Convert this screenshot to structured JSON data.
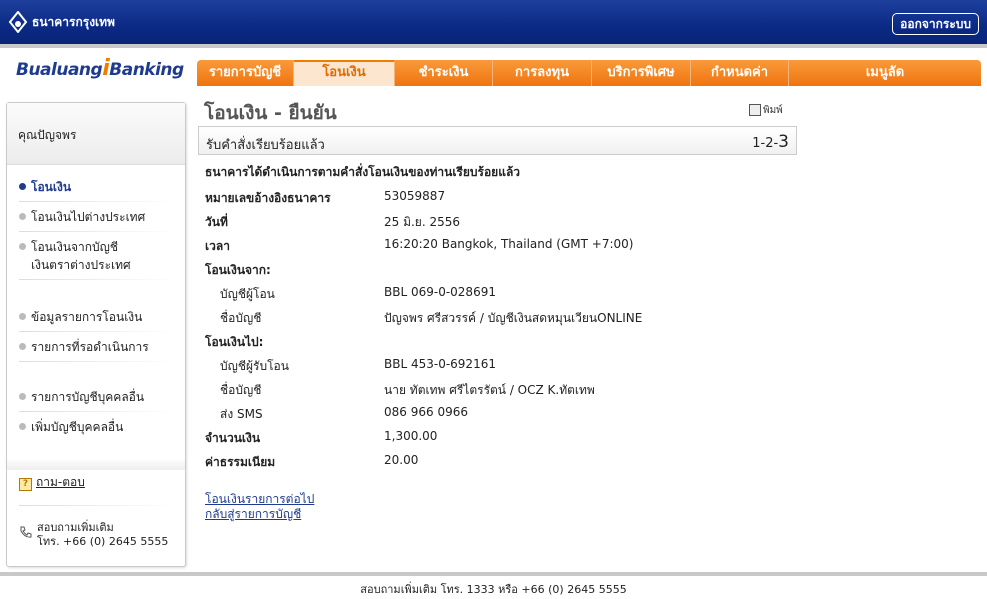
{
  "header": {
    "bank_name": "ธนาคารกรุงเทพ",
    "logout_label": "ออกจากระบบ"
  },
  "brand": {
    "part1": "Bualuang",
    "part2": "i",
    "part3": "Banking"
  },
  "nav": {
    "items": [
      {
        "label": "รายการบัญชี"
      },
      {
        "label": "โอนเงิน"
      },
      {
        "label": "ชำระเงิน"
      },
      {
        "label": "การลงทุน"
      },
      {
        "label": "บริการพิเศษ"
      },
      {
        "label": "กำหนดค่า"
      },
      {
        "label": "เมนูลัด"
      }
    ]
  },
  "sidebar": {
    "user_name": "คุณปัญจพร",
    "items": [
      {
        "label": "โอนเงิน"
      },
      {
        "label": "โอนเงินไปต่างประเทศ"
      },
      {
        "label": "โอนเงินจากบัญชี"
      },
      {
        "label": "เงินตราต่างประเทศ"
      },
      {
        "label": "ข้อมูลรายการโอนเงิน"
      },
      {
        "label": "รายการที่รอดำเนินการ"
      },
      {
        "label": "รายการบัญชีบุคคลอื่น"
      },
      {
        "label": "เพิ่มบัญชีบุคคลอื่น"
      }
    ],
    "faq_label": "ถาม-ตอบ",
    "contact_line1": "สอบถามเพิ่มเติม",
    "contact_line2": "โทร. +66 (0) 2645 5555"
  },
  "main": {
    "title": "โอนเงิน - ยืนยัน",
    "print_label": "พิมพ์",
    "status_text": "รับคำสั่งเรียบร้อยแล้ว",
    "step_prefix": "1-2-",
    "step_current": "3",
    "confirm_message": "ธนาคารได้ดำเนินการตามคำสั่งโอนเงินของท่านเรียบร้อยแล้ว",
    "details": {
      "ref_label": "หมายเลขอ้างอิงธนาคาร",
      "ref_value": "53059887",
      "date_label": "วันที่",
      "date_value": "25 มิ.ย. 2556",
      "time_label": "เวลา",
      "time_value": "16:20:20 Bangkok, Thailand (GMT +7:00)",
      "from_heading": "โอนเงินจาก:",
      "from_acct_label": "บัญชีผู้โอน",
      "from_acct_value": "BBL 069-0-028691",
      "from_name_label": "ชื่อบัญชี",
      "from_name_value": "ปัญจพร ศรีสวรรค์ / บัญชีเงินสดหมุนเวียนONLINE",
      "to_heading": "โอนเงินไป:",
      "to_acct_label": "บัญชีผู้รับโอน",
      "to_acct_value": "BBL 453-0-692161",
      "to_name_label": "ชื่อบัญชี",
      "to_name_value": "นาย ทัตเทพ ศรีไตรรัตน์ / OCZ K.ทัตเทพ",
      "sms_label": "ส่ง SMS",
      "sms_value": "086 966 0966",
      "amount_label": "จำนวนเงิน",
      "amount_value": "1,300.00",
      "fee_label": "ค่าธรรมเนียม",
      "fee_value": "20.00"
    },
    "link_next_transfer": "โอนเงินรายการต่อไป",
    "link_back_accounts": "กลับสู่รายการบัญชี"
  },
  "footer": {
    "text": "สอบถามเพิ่มเติม โทร. 1333 หรือ +66 (0) 2645 5555"
  }
}
